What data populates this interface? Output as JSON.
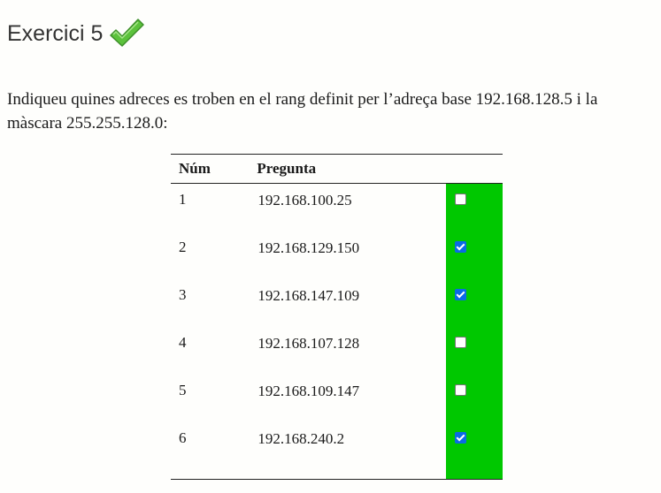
{
  "exercise": {
    "title": "Exercici 5",
    "status_icon": "green-check-icon",
    "status_color": "#4caf50"
  },
  "question": {
    "text": "Indiqueu quines adreces es troben en el rang definit per l’adreça base 192.168.128.5 i la màscara 255.255.128.0:"
  },
  "table": {
    "headers": {
      "num": "Núm",
      "question": "Pregunta",
      "answer": ""
    },
    "answer_column_color": "#00c800",
    "rows": [
      {
        "num": "1",
        "question": "192.168.100.25",
        "checked": false
      },
      {
        "num": "2",
        "question": "192.168.129.150",
        "checked": true
      },
      {
        "num": "3",
        "question": "192.168.147.109",
        "checked": true
      },
      {
        "num": "4",
        "question": "192.168.107.128",
        "checked": false
      },
      {
        "num": "5",
        "question": "192.168.109.147",
        "checked": false
      },
      {
        "num": "6",
        "question": "192.168.240.2",
        "checked": true
      }
    ]
  }
}
